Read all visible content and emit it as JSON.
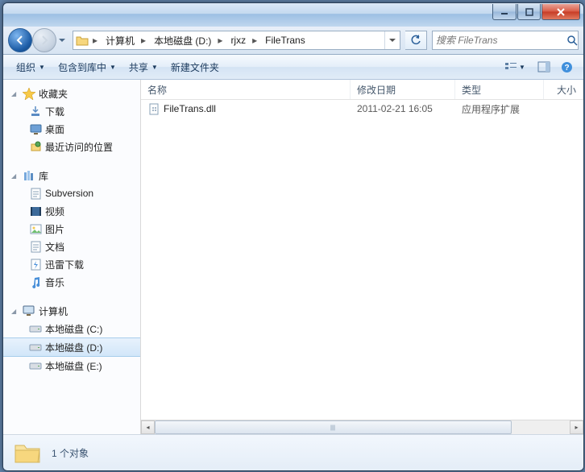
{
  "breadcrumb": {
    "segments": [
      "计算机",
      "本地磁盘 (D:)",
      "rjxz",
      "FileTrans"
    ]
  },
  "search": {
    "placeholder": "搜索 FileTrans"
  },
  "toolbar": {
    "organize": "组织",
    "include": "包含到库中",
    "share": "共享",
    "newfolder": "新建文件夹"
  },
  "columns": {
    "name": "名称",
    "date": "修改日期",
    "type": "类型",
    "size": "大小"
  },
  "files": [
    {
      "name": "FileTrans.dll",
      "date": "2011-02-21 16:05",
      "type": "应用程序扩展"
    }
  ],
  "nav": {
    "favorites": {
      "label": "收藏夹",
      "items": [
        "下载",
        "桌面",
        "最近访问的位置"
      ]
    },
    "libraries": {
      "label": "库",
      "items": [
        "Subversion",
        "视频",
        "图片",
        "文档",
        "迅雷下载",
        "音乐"
      ]
    },
    "computer": {
      "label": "计算机",
      "items": [
        "本地磁盘 (C:)",
        "本地磁盘 (D:)",
        "本地磁盘 (E:)"
      ],
      "selected": 1
    }
  },
  "status": {
    "text": "1 个对象"
  }
}
